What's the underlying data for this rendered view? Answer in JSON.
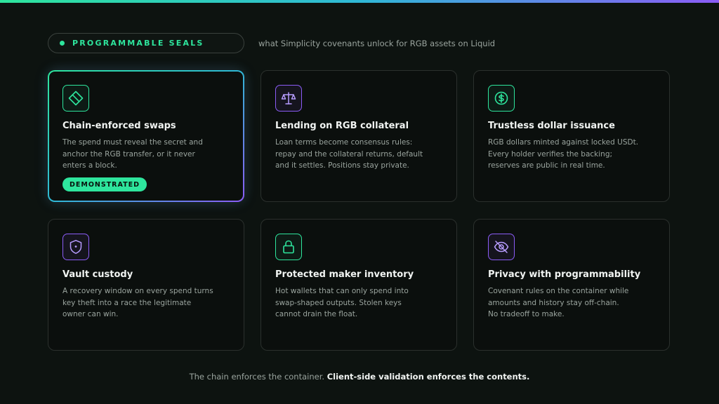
{
  "header": {
    "pill_label": "PROGRAMMABLE SEALS",
    "subtitle": "what Simplicity covenants unlock for RGB assets on Liquid"
  },
  "colors": {
    "accent_green": "#2ee59d",
    "accent_purple": "#8b5cf6",
    "accent_cyan": "#2fb8d6",
    "background": "#0d1310",
    "card_background": "#0b0f0d"
  },
  "cards": [
    {
      "title": "Chain-enforced swaps",
      "lines": [
        "The spend must reveal the secret and",
        "anchor the RGB transfer, or it never",
        "enters a block."
      ],
      "icon": "diamond-swap-icon",
      "badge": "DEMONSTRATED"
    },
    {
      "title": "Lending on RGB collateral",
      "lines": [
        "Loan terms become consensus rules:",
        "repay and the collateral returns, default",
        "and it settles. Positions stay private."
      ],
      "icon": "scales-icon"
    },
    {
      "title": "Trustless dollar issuance",
      "lines": [
        "RGB dollars minted against locked USDt.",
        "Every holder verifies the backing;",
        "reserves are public in real time."
      ],
      "icon": "dollar-coin-icon"
    },
    {
      "title": "Vault custody",
      "lines": [
        "A recovery window on every spend turns",
        "key theft into a race the legitimate",
        "owner can win."
      ],
      "icon": "shield-icon"
    },
    {
      "title": "Protected maker inventory",
      "lines": [
        "Hot wallets that can only spend into",
        "swap-shaped outputs. Stolen keys",
        "cannot drain the float."
      ],
      "icon": "padlock-icon"
    },
    {
      "title": "Privacy with programmability",
      "lines": [
        "Covenant rules on the container while",
        "amounts and history stay off-chain.",
        "No tradeoff to make."
      ],
      "icon": "eye-slash-icon"
    }
  ],
  "footer": {
    "plain": "The chain enforces the container.",
    "strong": "Client-side validation enforces the contents."
  }
}
